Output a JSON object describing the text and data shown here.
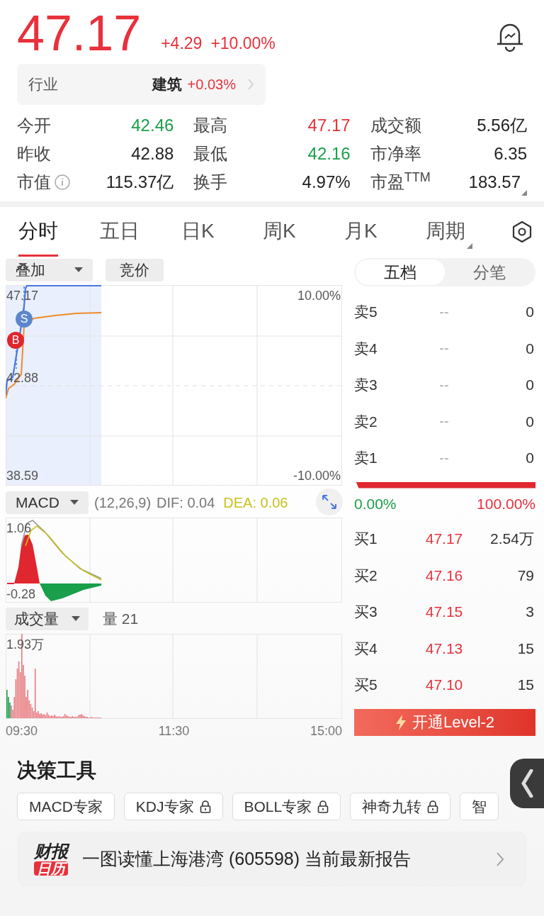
{
  "quote": {
    "price": "47.17",
    "change": "+4.29",
    "change_pct": "+10.00%"
  },
  "industry": {
    "label": "行业",
    "name": "建筑",
    "change": "+0.03%"
  },
  "stats": [
    {
      "label": "今开",
      "value": "42.46",
      "color": "#1a9f4a",
      "info": false,
      "expandable": false
    },
    {
      "label": "最高",
      "value": "47.17",
      "color": "#e8313b",
      "info": false,
      "expandable": false
    },
    {
      "label": "成交额",
      "value": "5.56亿",
      "color": "#1f1f1f",
      "info": false,
      "expandable": false
    },
    {
      "label": "昨收",
      "value": "42.88",
      "color": "#1f1f1f",
      "info": false,
      "expandable": false
    },
    {
      "label": "最低",
      "value": "42.16",
      "color": "#1a9f4a",
      "info": false,
      "expandable": false
    },
    {
      "label": "市净率",
      "value": "6.35",
      "color": "#1f1f1f",
      "info": false,
      "expandable": false
    },
    {
      "label": "市值",
      "value": "115.37亿",
      "color": "#1f1f1f",
      "info": true,
      "expandable": false
    },
    {
      "label": "换手",
      "value": "4.97%",
      "color": "#1f1f1f",
      "info": false,
      "expandable": false
    },
    {
      "label": "市盈$^{TTM}$",
      "value": "183.57",
      "color": "#1f1f1f",
      "info": false,
      "expandable": true
    }
  ],
  "tabs": [
    {
      "label": "分时",
      "selected": true,
      "expandable": false
    },
    {
      "label": "五日",
      "selected": false,
      "expandable": false
    },
    {
      "label": "日K",
      "selected": false,
      "expandable": false
    },
    {
      "label": "周K",
      "selected": false,
      "expandable": false
    },
    {
      "label": "月K",
      "selected": false,
      "expandable": false
    },
    {
      "label": "周期",
      "selected": false,
      "expandable": true
    }
  ],
  "chart_controls": {
    "overlay": "叠加",
    "auction": "竞价"
  },
  "intraday": {
    "price_ticks": [
      "47.17",
      "42.88",
      "38.59"
    ],
    "pct_ticks": [
      "10.00%",
      "-10.00%"
    ],
    "trade_marks": [
      {
        "label": "S",
        "kind": "sell"
      },
      {
        "label": "B",
        "kind": "buy"
      }
    ]
  },
  "macd": {
    "selector": "MACD",
    "params": "(12,26,9)",
    "dif": "DIF: 0.04",
    "dea": "DEA: 0.06",
    "ticks": [
      "1.06",
      "-0.28"
    ]
  },
  "volume": {
    "selector": "成交量",
    "reading": "量 21",
    "ticks": [
      "1.93万"
    ]
  },
  "time_labels": [
    "09:30",
    "11:30",
    "15:00"
  ],
  "book_tabs": [
    {
      "label": "五档",
      "selected": true
    },
    {
      "label": "分笔",
      "selected": false
    }
  ],
  "asks": [
    {
      "label": "卖5",
      "price": "--",
      "volume": "0"
    },
    {
      "label": "卖4",
      "price": "--",
      "volume": "0"
    },
    {
      "label": "卖3",
      "price": "--",
      "volume": "0"
    },
    {
      "label": "卖2",
      "price": "--",
      "volume": "0"
    },
    {
      "label": "卖1",
      "price": "--",
      "volume": "0"
    }
  ],
  "balance": {
    "level": 1,
    "left_pct": "0.00%",
    "right_pct": "100.00%"
  },
  "bids": [
    {
      "label": "买1",
      "price": "47.17",
      "volume": "2.54万"
    },
    {
      "label": "买2",
      "price": "47.16",
      "volume": "79"
    },
    {
      "label": "买3",
      "price": "47.15",
      "volume": "3"
    },
    {
      "label": "买4",
      "price": "47.13",
      "volume": "15"
    },
    {
      "label": "买5",
      "price": "47.10",
      "volume": "15"
    }
  ],
  "level2_button": "开通Level-2",
  "tools": {
    "title": "决策工具",
    "chips": [
      {
        "label": "MACD专家",
        "locked": false
      },
      {
        "label": "KDJ专家",
        "locked": true
      },
      {
        "label": "BOLL专家",
        "locked": true
      },
      {
        "label": "神奇九转",
        "locked": true
      },
      {
        "label": "智",
        "locked": false
      }
    ]
  },
  "report": {
    "logo_top": "财报",
    "logo_bottom": "日历",
    "text": "一图读懂上海港湾 (605598) 当前最新报告"
  }
}
